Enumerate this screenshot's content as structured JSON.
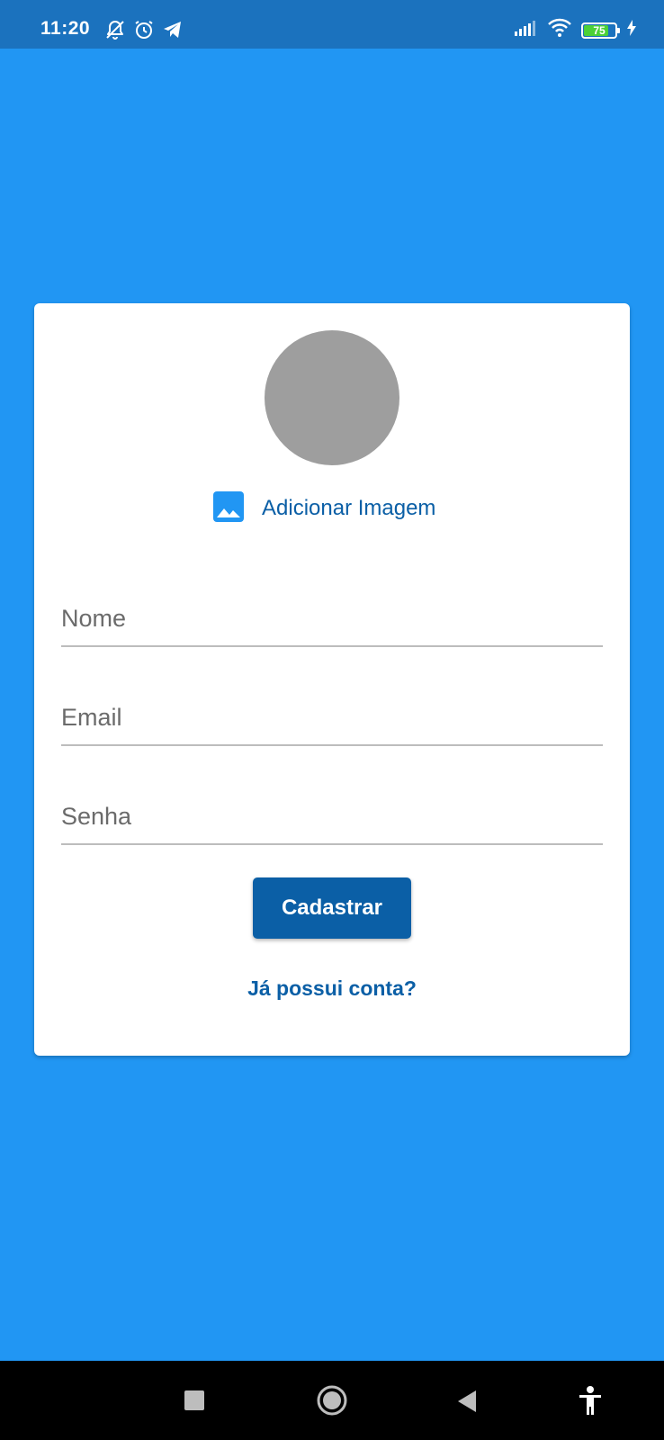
{
  "status_bar": {
    "time": "11:20",
    "battery_level": "75",
    "icons": [
      "notifications-off-icon",
      "alarm-icon",
      "telegram-icon",
      "signal-icon",
      "wifi-icon",
      "battery-icon",
      "charging-icon"
    ]
  },
  "form": {
    "add_image_label": "Adicionar Imagem",
    "fields": {
      "name_placeholder": "Nome",
      "email_placeholder": "Email",
      "password_placeholder": "Senha"
    },
    "submit_label": "Cadastrar",
    "login_link_label": "Já possui conta?"
  },
  "nav_bar": {
    "buttons": [
      "recent-apps-icon",
      "home-icon",
      "back-icon",
      "accessibility-icon"
    ]
  },
  "colors": {
    "background": "#2196F3",
    "status_bar": "#1B72BE",
    "card": "#FFFFFF",
    "primary": "#0B5FA6",
    "avatar": "#9E9E9E",
    "image_icon": "#2196F3",
    "battery_fill": "#4CD137"
  }
}
